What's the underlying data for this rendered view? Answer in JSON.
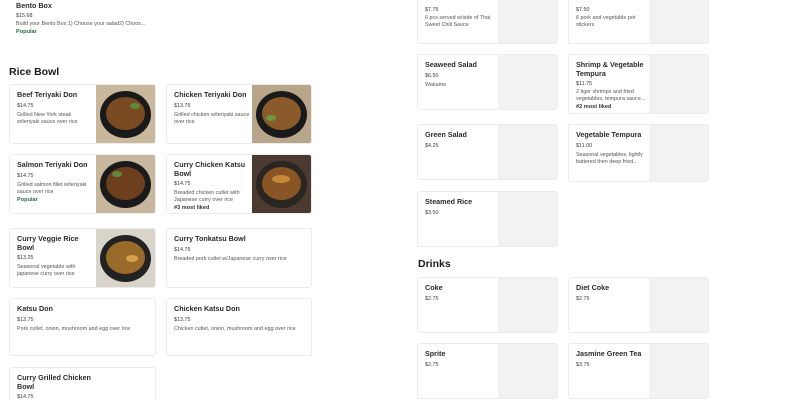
{
  "top_left": {
    "bento": {
      "name": "Bento Box",
      "price": "$15.68",
      "desc": "Build your Bento Box:1) Choose your salad2) Choos...",
      "badge": "Popular"
    }
  },
  "top_right": [
    {
      "price": "$7.75",
      "desc": "6 pcs served w/side of Thai Sweet Chili Sauce"
    },
    {
      "price": "$7.50",
      "desc": "6 pork and vegetable pot stickers"
    }
  ],
  "sections": {
    "rice_bowl": "Rice Bowl",
    "drinks": "Drinks"
  },
  "rice_bowl_items": [
    {
      "name": "Beef Teriyaki Don",
      "price": "$14.75",
      "desc": "Grilled New York steak w/teriyaki sauce over rice",
      "badge": ""
    },
    {
      "name": "Chicken Teriyaki Don",
      "price": "$13.75",
      "desc": "Grilled chicken w/teriyaki sauce over rice",
      "badge": ""
    },
    {
      "name": "Salmon Teriyaki Don",
      "price": "$14.75",
      "desc": "Grilled salmon fillet w/teriyaki sauce over rice",
      "badge": "Popular"
    },
    {
      "name": "Curry Chicken Katsu Bowl",
      "price": "$14.75",
      "desc": "Breaded chicken cutlet with Japanese curry over rice",
      "badge": "#3 most liked"
    },
    {
      "name": "Curry Veggie Rice Bowl",
      "price": "$13.25",
      "desc": "Seasonal vegetable with japanese curry over rice",
      "badge": ""
    },
    {
      "name": "Curry Tonkatsu Bowl",
      "price": "$14.75",
      "desc": "Breaded pork cutlet w/Japanese curry over rice",
      "badge": ""
    },
    {
      "name": "Katsu Don",
      "price": "$13.75",
      "desc": "Pork cutlet, onion, mushroom and egg over rice",
      "badge": ""
    },
    {
      "name": "Chicken Katsu Don",
      "price": "$13.75",
      "desc": "Chicken cutlet, onion, mushroom and egg over rice",
      "badge": ""
    },
    {
      "name": "Curry Grilled Chicken Bowl",
      "price": "$14.75",
      "desc": "",
      "badge": ""
    }
  ],
  "right_items": [
    {
      "name": "Seaweed Salad",
      "price": "$6.50",
      "desc": "Wakame",
      "badge": ""
    },
    {
      "name": "Shrimp & Vegetable Tempura",
      "price": "$11.75",
      "desc": "2 tiger shrimps and fried vegetables, tempura sauce...",
      "badge": "#2 most liked"
    },
    {
      "name": "Green Salad",
      "price": "$4.25",
      "desc": "",
      "badge": ""
    },
    {
      "name": "Vegetable Tempura",
      "price": "$11.00",
      "desc": "Seasonal vegetables, lightly battered then deep fried...",
      "badge": ""
    },
    {
      "name": "Steamed Rice",
      "price": "$3.50",
      "desc": "",
      "badge": ""
    }
  ],
  "drinks": [
    {
      "name": "Coke",
      "price": "$2.75"
    },
    {
      "name": "Diet Coke",
      "price": "$2.75"
    },
    {
      "name": "Sprite",
      "price": "$2.75"
    },
    {
      "name": "Jasmine Green Tea",
      "price": "$3.75"
    }
  ],
  "colors": {
    "popular": "#2b6b3f",
    "card_border": "#ececec",
    "thumb_placeholder": "#f2f2f2"
  }
}
